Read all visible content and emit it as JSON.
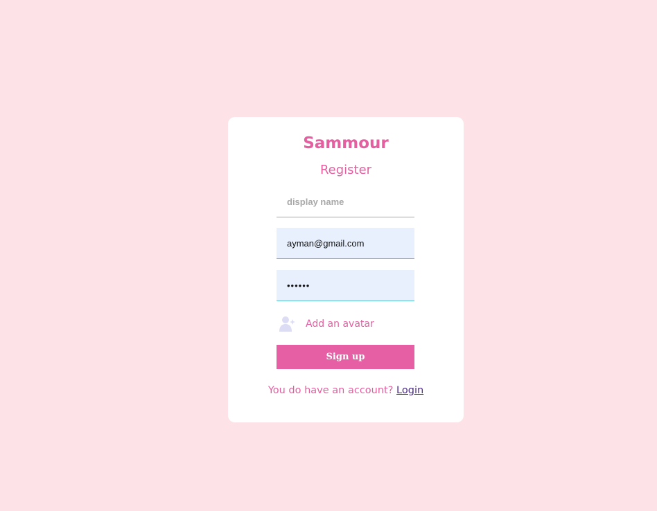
{
  "app": {
    "logo_text": "Sammour",
    "form_title": "Register"
  },
  "form": {
    "display_name": {
      "value": "",
      "placeholder": "display name"
    },
    "email": {
      "value": "ayman@gmail.com",
      "placeholder": ""
    },
    "password": {
      "value": "••••••",
      "placeholder": ""
    },
    "avatar": {
      "label": "Add an avatar",
      "icon": "add-user-icon"
    },
    "submit_label": "Sign up"
  },
  "footer": {
    "prompt": "You do have an account?",
    "login_label": "Login"
  },
  "colors": {
    "page_background": "#fde3e7",
    "accent": "#e35f9f",
    "button": "#e65fa4",
    "input_autofill": "#e8f0fe",
    "input_underline": "#5dc3cf",
    "link": "#4b2a8a"
  }
}
